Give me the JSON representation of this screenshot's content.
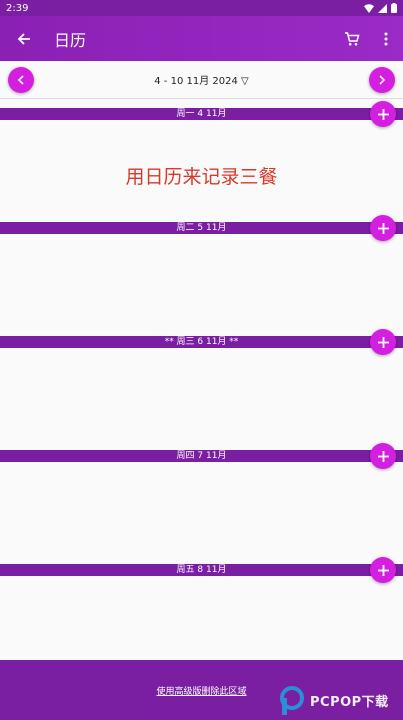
{
  "status_bar": {
    "time": "2:39"
  },
  "app_bar": {
    "title": "日历",
    "back_icon": "arrow-back-icon",
    "cart_icon": "cart-icon",
    "menu_icon": "more-vert-icon"
  },
  "date_nav": {
    "range": "4 - 10 11月 2024 ▽",
    "prev_icon": "chevron-left-icon",
    "next_icon": "chevron-right-icon"
  },
  "promo_text": "用日历来记录三餐",
  "days": [
    {
      "label": "周一 4 11月"
    },
    {
      "label": "周二 5 11月"
    },
    {
      "label": "** 周三 6 11月 **"
    },
    {
      "label": "周四 7 11月"
    },
    {
      "label": "周五 8 11月"
    }
  ],
  "bottom_bar": {
    "link": "使用高级版删除此区域"
  },
  "watermark": {
    "text": "PCPOP下载"
  },
  "colors": {
    "primary": "#7b1fa2",
    "accent": "#d51fe0",
    "promo": "#d8392b"
  }
}
